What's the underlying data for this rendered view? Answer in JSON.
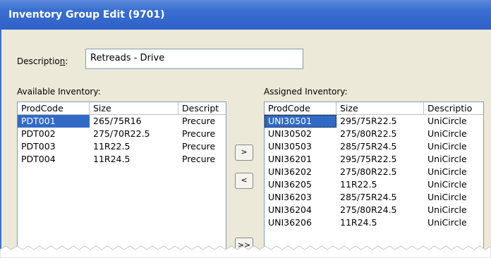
{
  "window": {
    "title": "Inventory Group Edit (9701)"
  },
  "description": {
    "label_prefix": "Descriptio",
    "label_mnemonic": "n",
    "label_suffix": ":",
    "value": "Retreads - Drive"
  },
  "available": {
    "label": "Available Inventory:",
    "columns": [
      "ProdCode",
      "Size",
      "Descript"
    ],
    "rows": [
      [
        "PDT001",
        "265/75R16",
        "Precure"
      ],
      [
        "PDT002",
        "275/70R22.5",
        "Precure"
      ],
      [
        "PDT003",
        "11R22.5",
        "Precure"
      ],
      [
        "PDT004",
        "11R24.5",
        "Precure"
      ]
    ]
  },
  "assigned": {
    "label": "Assigned Inventory:",
    "columns": [
      "ProdCode",
      "Size",
      "Descriptio"
    ],
    "rows": [
      [
        "UNI30501",
        "295/75R22.5",
        "UniCircle"
      ],
      [
        "UNI30502",
        "275/80R22.5",
        "UniCircle"
      ],
      [
        "UNI30503",
        "285/75R24.5",
        "UniCircle"
      ],
      [
        "UNI36201",
        "295/75R22.5",
        "UniCircle"
      ],
      [
        "UNI36202",
        "275/80R22.5",
        "UniCircle"
      ],
      [
        "UNI36205",
        "11R22.5",
        "UniCircle"
      ],
      [
        "UNI36203",
        "285/75R24.5",
        "UniCircle"
      ],
      [
        "UNI36204",
        "275/80R24.5",
        "UniCircle"
      ],
      [
        "UNI36206",
        "11R24.5",
        "UniCircle"
      ]
    ]
  },
  "buttons": {
    "add": ">",
    "remove": "<",
    "add_all": ">>"
  },
  "colors": {
    "title_bar": "#3a6fd0",
    "selection": "#316ac5",
    "dialog_bg": "#ece9d8"
  }
}
